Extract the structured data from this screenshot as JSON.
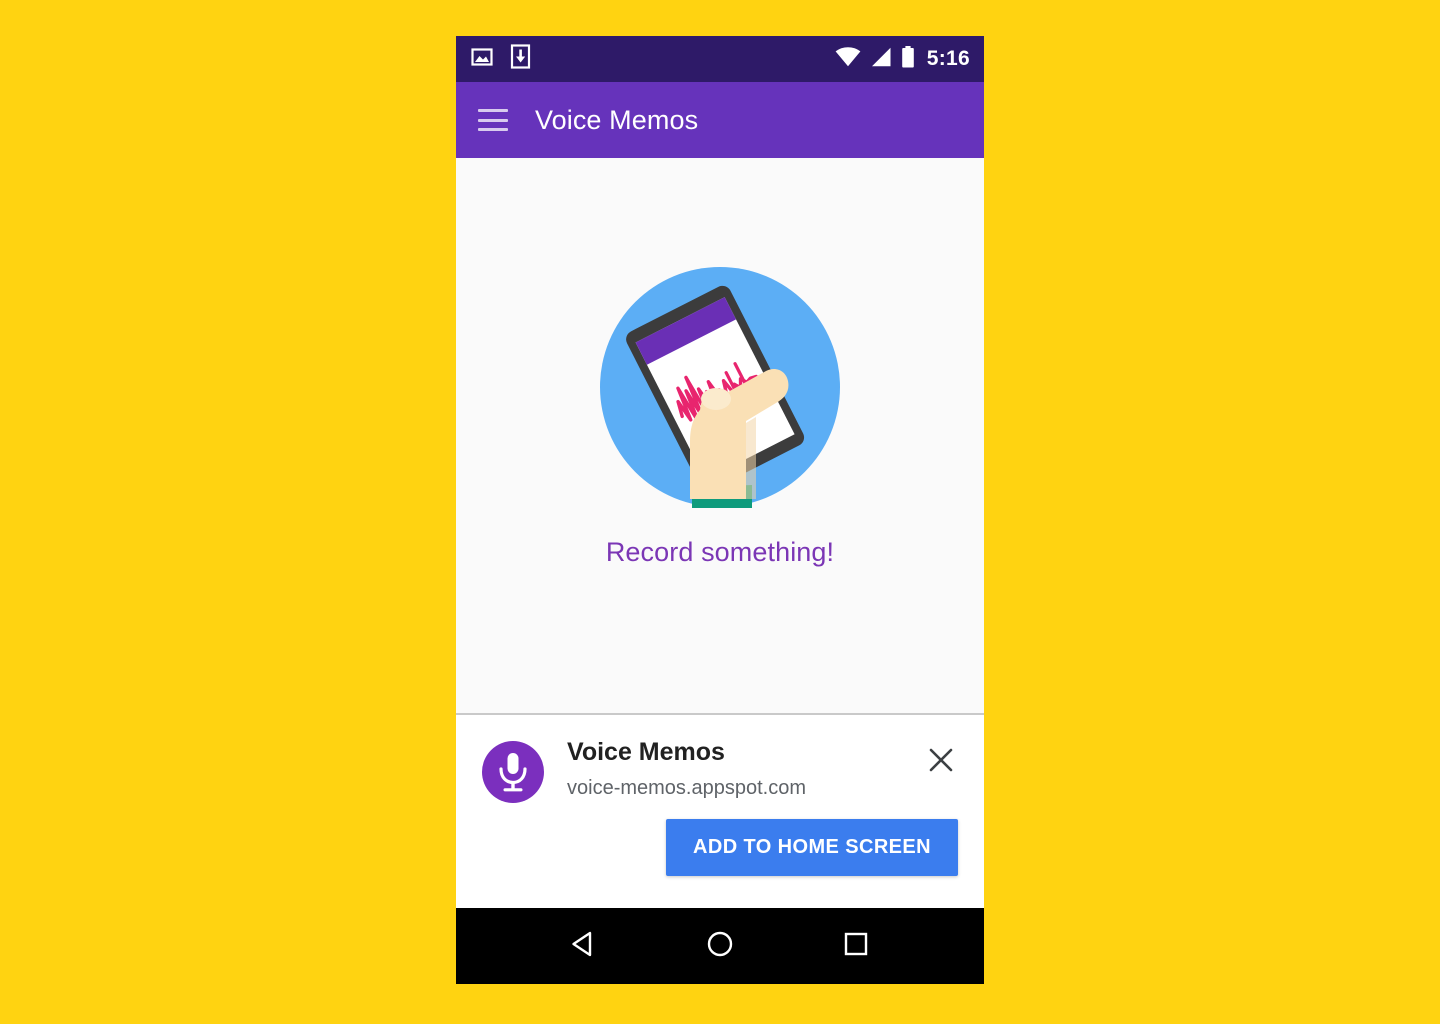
{
  "status_bar": {
    "background": "#2E1A68",
    "left_icons": [
      {
        "name": "image-icon",
        "label": "Screenshot captured"
      },
      {
        "name": "download-icon",
        "label": "Download complete"
      }
    ],
    "right_icons": [
      {
        "name": "wifi-icon",
        "label": "Wi-Fi connected"
      },
      {
        "name": "cellular-signal-icon",
        "label": "Cellular signal"
      },
      {
        "name": "battery-icon",
        "label": "Battery"
      }
    ],
    "time": "5:16"
  },
  "app_bar": {
    "background": "#6633BB",
    "menu_icon": "hamburger-menu-icon",
    "title": "Voice Memos"
  },
  "content": {
    "background": "#FAFAFA",
    "illustration": {
      "name": "hand-holding-phone-recording-illustration",
      "circle_color": "#5CAEF5",
      "phone_body_color": "#3C3C3C",
      "phone_screen_color": "#FFFFFF",
      "phone_app_bar_color": "#6A2FB5",
      "waveform_color": "#E8256E",
      "skin_color": "#FAE0B5",
      "sleeve_color": "#0E9B7C"
    },
    "empty_state_text": "Record something!",
    "empty_state_color": "#7B36B5"
  },
  "banner": {
    "app_icon": {
      "name": "microphone-icon",
      "background": "#7B2FBE",
      "glyph_color": "#FFFFFF"
    },
    "title": "Voice Memos",
    "url": "voice-memos.appspot.com",
    "close_icon": "close-icon",
    "add_button_label": "ADD TO HOME SCREEN",
    "add_button_color": "#3B7DEE"
  },
  "nav_bar": {
    "background": "#000000",
    "buttons": [
      {
        "name": "nav-back-button",
        "icon": "back-triangle-icon"
      },
      {
        "name": "nav-home-button",
        "icon": "home-circle-icon"
      },
      {
        "name": "nav-recents-button",
        "icon": "recents-square-icon"
      }
    ]
  },
  "page": {
    "background": "#FFD311"
  }
}
